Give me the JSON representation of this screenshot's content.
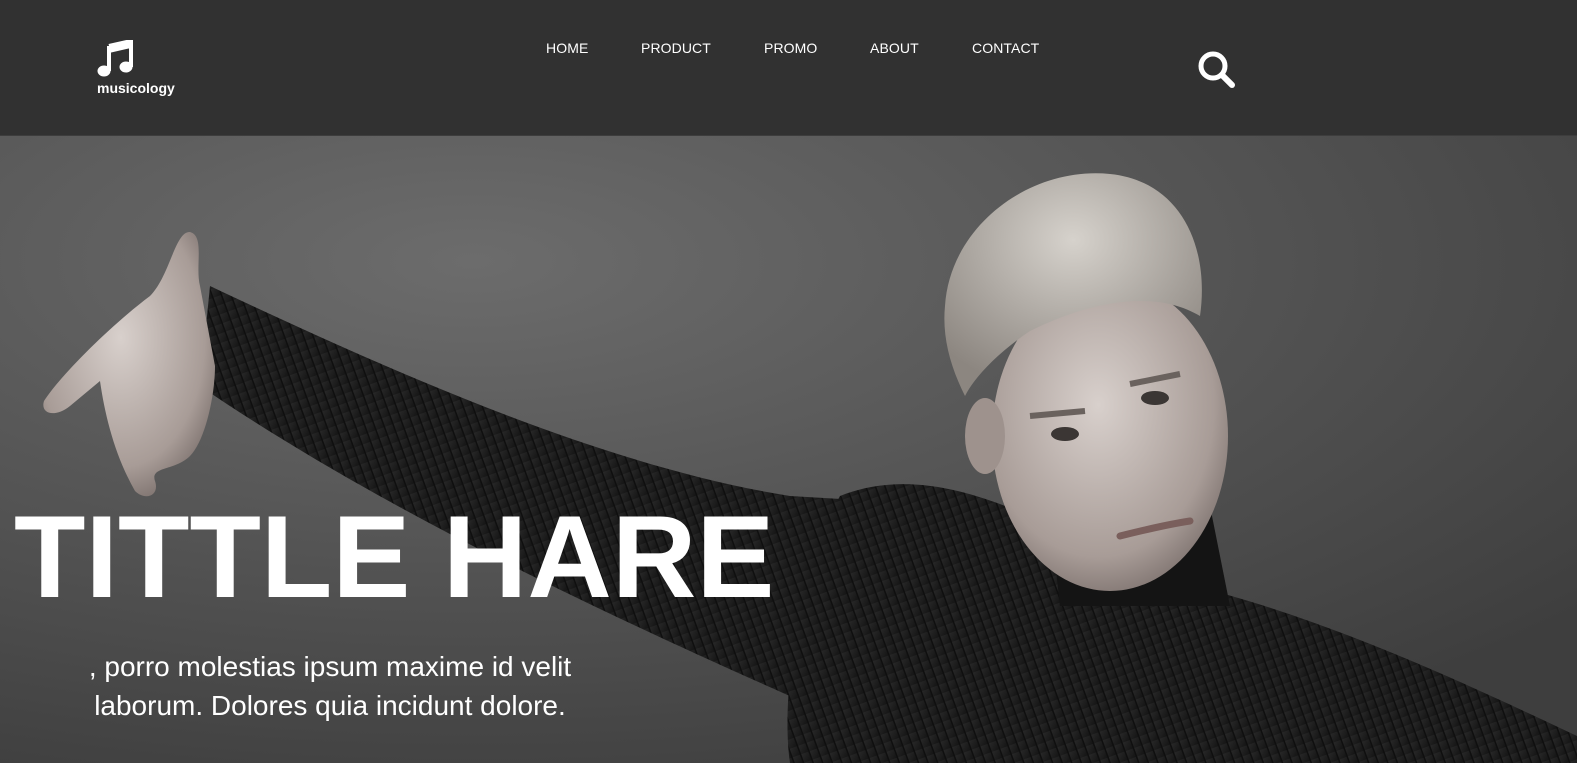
{
  "brand": {
    "name": "musicology",
    "logo_icon": "music-note-icon"
  },
  "nav": {
    "items": [
      {
        "label": "HOME"
      },
      {
        "label": "PRODUCT"
      },
      {
        "label": "PROMO"
      },
      {
        "label": "ABOUT"
      },
      {
        "label": "CONTACT"
      }
    ]
  },
  "search": {
    "icon": "search-icon"
  },
  "hero": {
    "title": "TITTLE HARE",
    "subtitle": ", porro molestias ipsum maxime id velit laborum. Dolores quia incidunt dolore."
  },
  "colors": {
    "header_bg": "#313131",
    "text": "#ffffff"
  }
}
